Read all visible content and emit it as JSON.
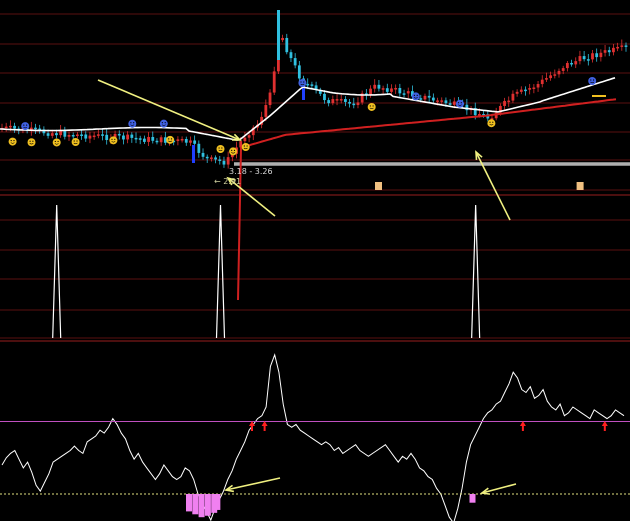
{
  "annotations": {
    "price_range": "3.18 - 3.26",
    "low_label": "2.91"
  },
  "colors": {
    "background": "#000000",
    "grid": "#5a1010",
    "candle_up": "#e03030",
    "candle_down": "#30c0e0",
    "ma_fast": "#ffffff",
    "ma_slow": "#d02020",
    "signal_line": "#ffffff",
    "oscillator": "#ffffff",
    "threshold": "#c050c0",
    "histogram": "#f080f0",
    "arrow": "#f0f080",
    "buy_marker": "#ff2020",
    "smiley_yellow": "#f0c020",
    "smiley_blue": "#4060e0"
  },
  "icons": {
    "buy_smiley": "smiley-face",
    "sell_smiley": "blue-smiley-face",
    "mini_tag": "square-tag",
    "buy_arrow": "up-arrow"
  },
  "chart_data": [
    {
      "type": "candlestick",
      "panel": "price",
      "series": [
        {
          "type": "candles",
          "pattern": "down-trend to low, spike, consolidation, rally"
        },
        {
          "type": "line",
          "role": "fast moving average"
        },
        {
          "type": "line",
          "role": "slow moving average"
        }
      ],
      "markers": {
        "smileys_yellow_at": [
          0.02,
          0.05,
          0.09,
          0.12,
          0.18,
          0.27,
          0.35,
          0.37,
          0.39,
          0.59,
          0.78
        ],
        "smileys_blue_at": [
          0.04,
          0.21,
          0.26,
          0.48,
          0.66,
          0.73,
          0.94
        ],
        "tags_at": [
          0.6,
          0.92
        ]
      }
    },
    {
      "type": "line",
      "panel": "signal",
      "series": [
        {
          "type": "spikes",
          "x": [
            0.09,
            0.35,
            0.755
          ],
          "values": [
            1.0,
            1.0,
            1.0
          ],
          "baseline": 0
        }
      ]
    },
    {
      "type": "line",
      "panel": "oscillator",
      "series": [
        {
          "type": "line",
          "values": [
            20,
            25,
            28,
            30,
            24,
            18,
            22,
            15,
            6,
            2,
            8,
            14,
            22,
            24,
            26,
            28,
            30,
            33,
            30,
            28,
            36,
            38,
            40,
            44,
            42,
            46,
            52,
            48,
            42,
            38,
            30,
            24,
            28,
            22,
            18,
            14,
            10,
            14,
            20,
            16,
            12,
            10,
            12,
            18,
            16,
            10,
            0,
            -6,
            -12,
            -18,
            -10,
            -4,
            2,
            10,
            16,
            24,
            30,
            36,
            44,
            48,
            52,
            54,
            60,
            88,
            96,
            84,
            62,
            48,
            46,
            48,
            44,
            42,
            40,
            38,
            36,
            34,
            36,
            34,
            30,
            32,
            28,
            30,
            32,
            34,
            30,
            28,
            26,
            28,
            30,
            32,
            34,
            30,
            26,
            22,
            26,
            24,
            28,
            24,
            18,
            16,
            12,
            10,
            4,
            0,
            -8,
            -16,
            -20,
            -10,
            4,
            22,
            34,
            40,
            46,
            52,
            56,
            58,
            62,
            64,
            70,
            76,
            84,
            80,
            72,
            70,
            74,
            66,
            68,
            72,
            64,
            60,
            58,
            62,
            54,
            56,
            60,
            58,
            56,
            54,
            52,
            58,
            56,
            54,
            52,
            54,
            58,
            56,
            54
          ]
        },
        {
          "type": "bars",
          "role": "histogram",
          "x": [
            0.3,
            0.31,
            0.32,
            0.33,
            0.34,
            0.345,
            0.75
          ],
          "values": [
            -12,
            -14,
            -16,
            -15,
            -13,
            -11,
            -6
          ]
        }
      ],
      "reference_lines": [
        {
          "role": "upper threshold",
          "value": 50
        },
        {
          "role": "lower threshold",
          "value": 0
        }
      ],
      "markers": {
        "buy_arrows_at": [
          0.4,
          0.42,
          0.83,
          0.96
        ]
      }
    }
  ]
}
